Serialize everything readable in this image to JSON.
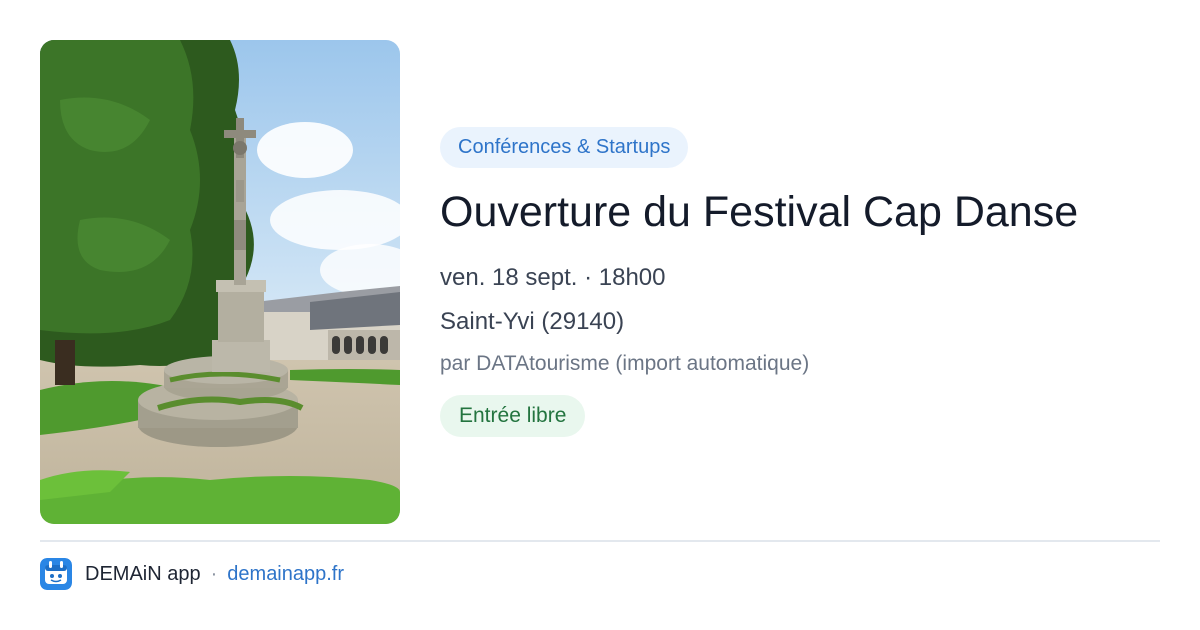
{
  "event": {
    "category": "Conférences & Startups",
    "title": "Ouverture du Festival Cap Danse",
    "datetime": "ven. 18 sept. · 18h00",
    "location": "Saint-Yvi (29140)",
    "organizer": "par DATAtourisme (import automatique)",
    "price": "Entrée libre"
  },
  "footer": {
    "app_name": "DEMAiN app",
    "separator": "·",
    "domain": "demainapp.fr"
  },
  "colors": {
    "category_chip_bg": "#eaf3fd",
    "category_chip_text": "#2e74c9",
    "price_chip_bg": "#e9f7ee",
    "price_chip_text": "#23743f",
    "link": "#2e74c9",
    "logo_blue": "#2a86e5"
  },
  "icons": {
    "app_logo": "demain-app-logo-icon"
  }
}
